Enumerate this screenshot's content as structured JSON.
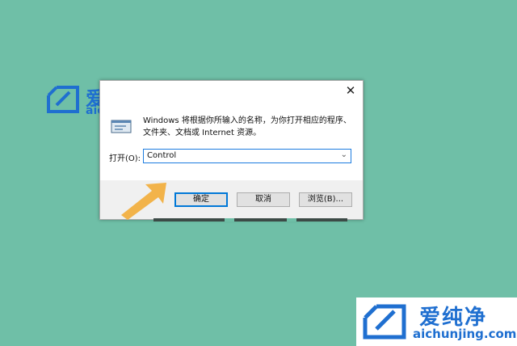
{
  "watermark": {
    "brand_cn": "爱纯净",
    "url": "aichunjing.com"
  },
  "dialog": {
    "close_glyph": "✕",
    "description": "Windows 将根据你所输入的名称，为你打开相应的程序、文件夹、文档或 Internet 资源。",
    "open_label": "打开(O):",
    "input_value": "Control",
    "ok_label": "确定",
    "cancel_label": "取消",
    "browse_label": "浏览(B)...",
    "icon": "run-program-icon"
  },
  "colors": {
    "background": "#6fbfa7",
    "brand_blue": "#1f6fd0",
    "arrow": "#f2b34a",
    "focus_blue": "#0078d7"
  }
}
